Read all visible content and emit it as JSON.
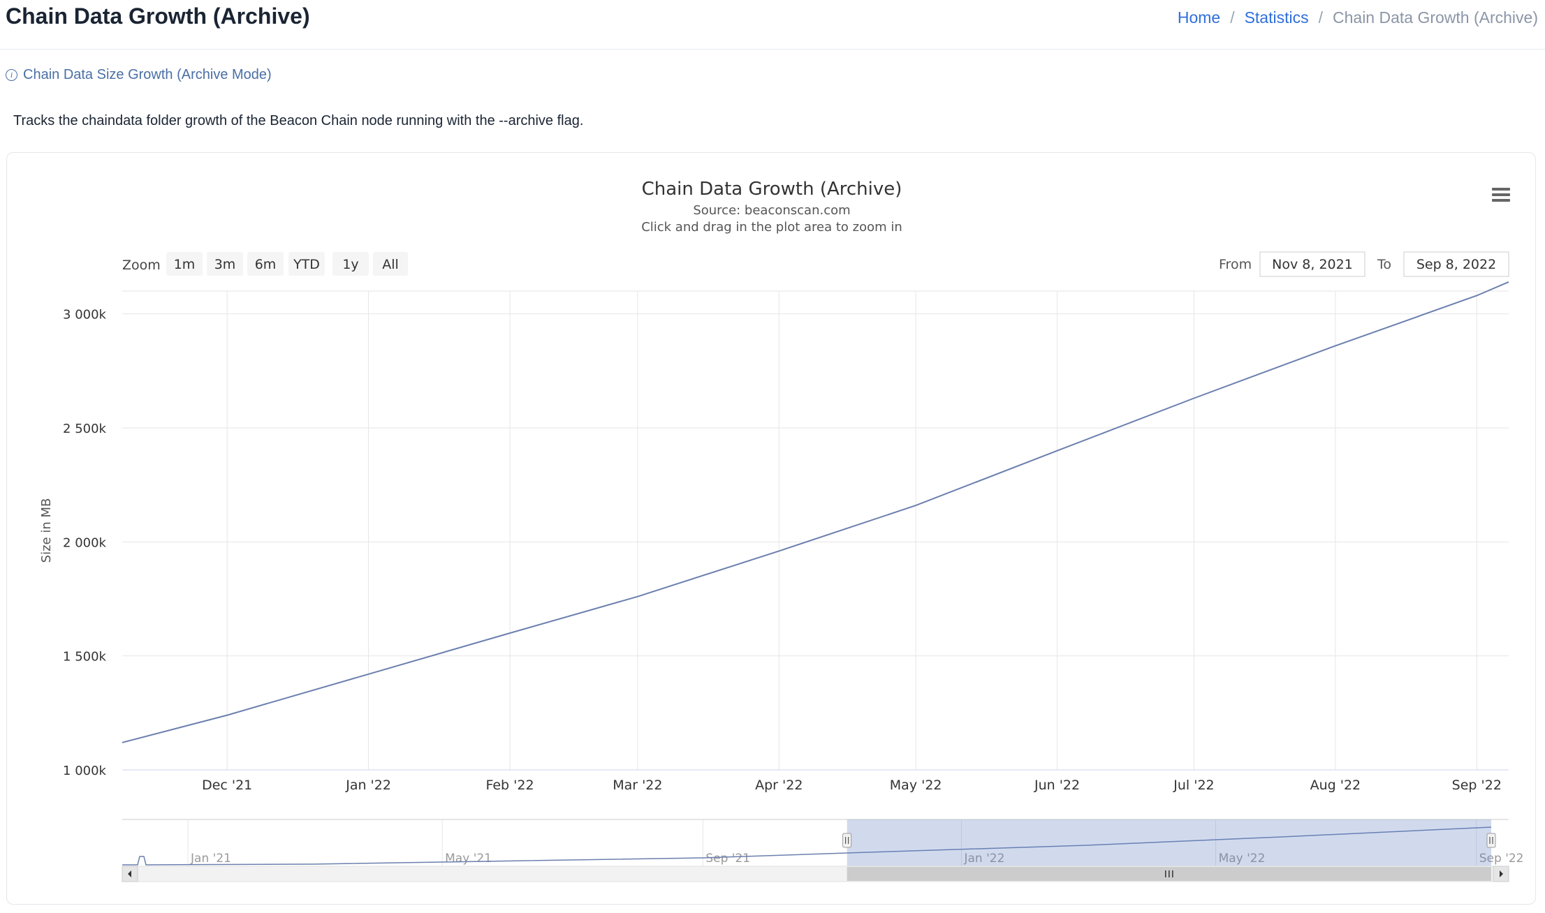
{
  "page": {
    "title": "Chain Data Growth (Archive)",
    "breadcrumb": [
      "Home",
      "Statistics",
      "Chain Data Growth (Archive)"
    ],
    "info_label": "Chain Data Size Growth (Archive Mode)",
    "description": "Tracks the chaindata folder growth of the Beacon Chain node running with the --archive flag."
  },
  "chart_controls": {
    "zoom_label": "Zoom",
    "zoom_buttons": [
      "1m",
      "3m",
      "6m",
      "YTD",
      "1y",
      "All"
    ],
    "from_label": "From",
    "from_value": "Nov 8, 2021",
    "to_label": "To",
    "to_value": "Sep 8, 2022",
    "menu_icon": "hamburger-menu-icon"
  },
  "colors": {
    "series_line": "#6b7fae",
    "navigator_mask": "rgba(102,133,194,0.30)",
    "grid": "#e6e6e6"
  },
  "chart_data": {
    "type": "line",
    "title": "Chain Data Growth (Archive)",
    "subtitle": "Source: beaconscan.com",
    "subtitle2": "Click and drag in the plot area to zoom in",
    "ylabel": "Size in MB",
    "xlabel": "",
    "xlim": [
      "2021-11-08",
      "2022-09-08"
    ],
    "ylim": [
      1000000,
      3100000
    ],
    "y_ticks": [
      1000000,
      1500000,
      2000000,
      2500000,
      3000000
    ],
    "y_tick_labels": [
      "1 000k",
      "1 500k",
      "2 000k",
      "2 500k",
      "3 000k"
    ],
    "x_ticks": [
      "2021-12-01",
      "2022-01-01",
      "2022-02-01",
      "2022-03-01",
      "2022-04-01",
      "2022-05-01",
      "2022-06-01",
      "2022-07-01",
      "2022-08-01",
      "2022-09-01"
    ],
    "x_tick_labels": [
      "Dec '21",
      "Jan '22",
      "Feb '22",
      "Mar '22",
      "Apr '22",
      "May '22",
      "Jun '22",
      "Jul '22",
      "Aug '22",
      "Sep '22"
    ],
    "grid": true,
    "legend": "none",
    "series": [
      {
        "x": [
          "2021-11-08",
          "2021-12-01",
          "2022-01-01",
          "2022-02-01",
          "2022-03-01",
          "2022-04-01",
          "2022-05-01",
          "2022-06-01",
          "2022-07-01",
          "2022-08-01",
          "2022-09-01",
          "2022-09-08"
        ],
        "values": [
          1120000,
          1240000,
          1420000,
          1600000,
          1760000,
          1960000,
          2160000,
          2400000,
          2630000,
          2860000,
          3080000,
          3140000
        ]
      }
    ],
    "navigator": {
      "xlim": [
        "2020-12-01",
        "2022-09-08"
      ],
      "tick_labels": [
        "Jan '21",
        "May '21",
        "Sep '21",
        "Jan '22",
        "May '22",
        "Sep '22"
      ],
      "tick_dates": [
        "2021-01-01",
        "2021-05-01",
        "2021-09-01",
        "2022-01-01",
        "2022-05-01",
        "2022-09-01"
      ],
      "selected_range": [
        "2021-11-08",
        "2022-09-08"
      ]
    }
  }
}
